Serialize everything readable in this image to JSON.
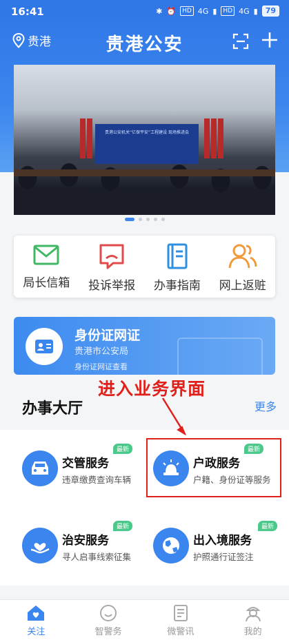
{
  "status_bar": {
    "time": "16:41",
    "hd1": "HD",
    "net1": "4G",
    "hd2": "HD",
    "net2": "4G",
    "battery": "79"
  },
  "header": {
    "location": "贵港",
    "title": "贵港公安"
  },
  "banner": {
    "stage_text": "贵港公安机关“亿保平安”工程建设 现场推进会"
  },
  "quick_actions": [
    {
      "label": "局长信箱",
      "icon": "mail-icon"
    },
    {
      "label": "投诉举报",
      "icon": "complaint-icon"
    },
    {
      "label": "办事指南",
      "icon": "guide-book-icon"
    },
    {
      "label": "网上返赃",
      "icon": "users-icon"
    }
  ],
  "id_card": {
    "title": "身份证网证",
    "subtitle": "贵港市公安局",
    "note": "身份证网证查看"
  },
  "annotation": {
    "text": "进入业务界面"
  },
  "hall": {
    "title": "办事大厅",
    "more": "更多",
    "services": [
      {
        "title": "交管服务",
        "desc": "违章缴费查询车辆",
        "badge": "最新",
        "icon": "car-icon"
      },
      {
        "title": "户政服务",
        "desc": "户籍、身份证等服务",
        "badge": "最新",
        "icon": "police-light-icon"
      },
      {
        "title": "治安服务",
        "desc": "寻人启事线索征集",
        "badge": "最新",
        "icon": "hand-heart-icon"
      },
      {
        "title": "出入境服务",
        "desc": "护照通行证签注",
        "badge": "最新",
        "icon": "globe-icon"
      }
    ]
  },
  "bottom_nav": [
    {
      "label": "关注",
      "active": true
    },
    {
      "label": "智警务",
      "active": false
    },
    {
      "label": "微警讯",
      "active": false
    },
    {
      "label": "我的",
      "active": false
    }
  ],
  "colors": {
    "primary": "#3b86ee",
    "annotation_red": "#e0201a",
    "badge_green": "#4cc98a"
  }
}
